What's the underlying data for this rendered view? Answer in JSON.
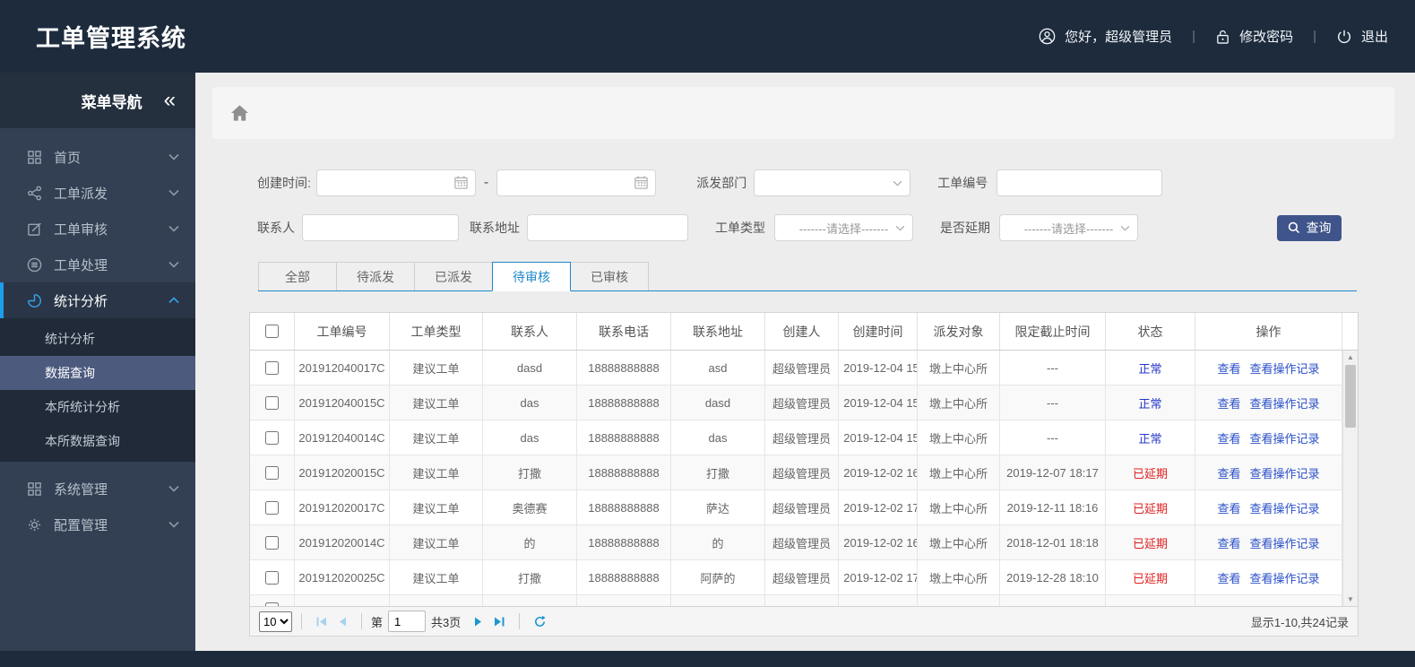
{
  "topbar": {
    "title": "工单管理系统",
    "greeting": "您好，超级管理员",
    "change_password": "修改密码",
    "logout": "退出"
  },
  "sidebar": {
    "nav_title": "菜单导航",
    "collapse_glyph": "«",
    "items": [
      {
        "label": "首页",
        "icon": "grid-icon"
      },
      {
        "label": "工单派发",
        "icon": "share-icon"
      },
      {
        "label": "工单审核",
        "icon": "edit-icon"
      },
      {
        "label": "工单处理",
        "icon": "database-icon"
      },
      {
        "label": "统计分析",
        "icon": "pie-chart-icon",
        "children": [
          "统计分析",
          "数据查询",
          "本所统计分析",
          "本所数据查询"
        ],
        "selected_child": "数据查询"
      },
      {
        "label": "系统管理",
        "icon": "grid-icon"
      },
      {
        "label": "配置管理",
        "icon": "gear-icon"
      }
    ]
  },
  "filters": {
    "creation_time_label": "创建时间:",
    "start_date_value": "",
    "range_separator": "-",
    "end_date_value": "",
    "dispatch_dept_label": "派发部门",
    "dispatch_dept_value": "",
    "order_no_label": "工单编号",
    "order_no_value": "",
    "contact_label": "联系人",
    "contact_value": "",
    "address_label": "联系地址",
    "address_value": "",
    "order_type_label": "工单类型",
    "order_type_value": "-------请选择-------",
    "delay_label": "是否延期",
    "delay_value": "-------请选择-------",
    "search_button": "查询"
  },
  "tabs": {
    "items": [
      "全部",
      "待派发",
      "已派发",
      "待审核",
      "已审核"
    ],
    "active": "待审核"
  },
  "table": {
    "columns": [
      "",
      "工单编号",
      "工单类型",
      "联系人",
      "联系电话",
      "联系地址",
      "创建人",
      "创建时间",
      "派发对象",
      "限定截止时间",
      "状态",
      "操作"
    ],
    "action_labels": [
      "查看",
      "查看操作记录"
    ],
    "status_colors": {
      "正常": "#2336c8",
      "已延期": "#e01f1f"
    },
    "rows": [
      {
        "order_no": "201912040017C",
        "order_type": "建议工单",
        "contact": "dasd",
        "phone": "18888888888",
        "address": "asd",
        "creator": "超级管理员",
        "created": "2019-12-04 15",
        "target": "墩上中心所",
        "deadline": "---",
        "status": "正常"
      },
      {
        "order_no": "201912040015C",
        "order_type": "建议工单",
        "contact": "das",
        "phone": "18888888888",
        "address": "dasd",
        "creator": "超级管理员",
        "created": "2019-12-04 15",
        "target": "墩上中心所",
        "deadline": "---",
        "status": "正常"
      },
      {
        "order_no": "201912040014C",
        "order_type": "建议工单",
        "contact": "das",
        "phone": "18888888888",
        "address": "das",
        "creator": "超级管理员",
        "created": "2019-12-04 15",
        "target": "墩上中心所",
        "deadline": "---",
        "status": "正常"
      },
      {
        "order_no": "201912020015C",
        "order_type": "建议工单",
        "contact": "打撒",
        "phone": "18888888888",
        "address": "打撒",
        "creator": "超级管理员",
        "created": "2019-12-02 16",
        "target": "墩上中心所",
        "deadline": "2019-12-07 18:17",
        "status": "已延期"
      },
      {
        "order_no": "201912020017C",
        "order_type": "建议工单",
        "contact": "奥德赛",
        "phone": "18888888888",
        "address": "萨达",
        "creator": "超级管理员",
        "created": "2019-12-02 17",
        "target": "墩上中心所",
        "deadline": "2019-12-11 18:16",
        "status": "已延期"
      },
      {
        "order_no": "201912020014C",
        "order_type": "建议工单",
        "contact": "的",
        "phone": "18888888888",
        "address": "的",
        "creator": "超级管理员",
        "created": "2019-12-02 16",
        "target": "墩上中心所",
        "deadline": "2018-12-01 18:18",
        "status": "已延期"
      },
      {
        "order_no": "201912020025C",
        "order_type": "建议工单",
        "contact": "打撒",
        "phone": "18888888888",
        "address": "阿萨的",
        "creator": "超级管理员",
        "created": "2019-12-02 17",
        "target": "墩上中心所",
        "deadline": "2019-12-28 18:10",
        "status": "已延期"
      }
    ]
  },
  "pagination": {
    "page_size": "10",
    "page_prefix": "第",
    "current_page": "1",
    "total_pages_label": "共3页",
    "record_info": "显示1-10,共24记录"
  }
}
